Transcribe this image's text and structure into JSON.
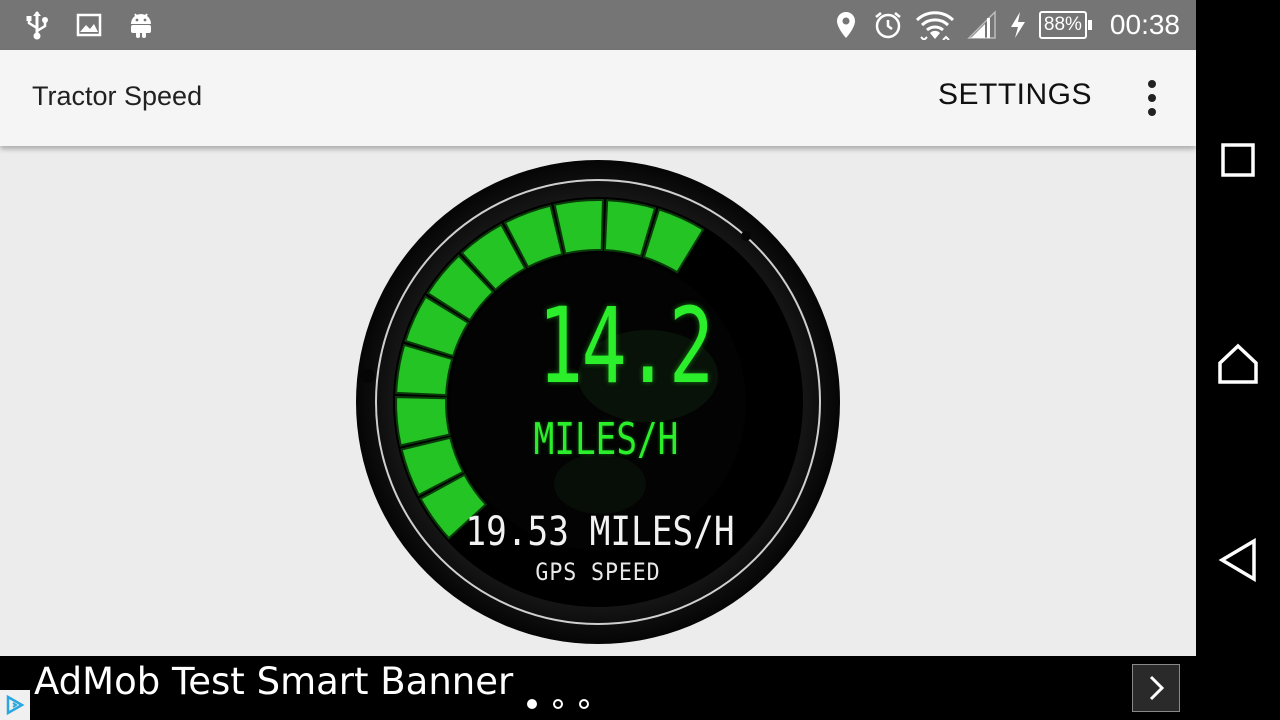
{
  "status_bar": {
    "left_icons": [
      "usb-icon",
      "image-icon",
      "android-icon"
    ],
    "right_icons": [
      "location-icon",
      "alarm-icon",
      "wifi-icon",
      "signal-icon",
      "charging-icon"
    ],
    "battery": "88%",
    "time": "00:38"
  },
  "app_bar": {
    "title": "Tractor Speed",
    "settings_label": "SETTINGS",
    "overflow_icon": "more-vert-icon"
  },
  "gauge": {
    "speed_value": "14.2",
    "speed_unit": "MILES/H",
    "gps_value": "19.53 MILES/H",
    "gps_label": "GPS SPEED",
    "lit_segments": 11,
    "accent_color": "#2bef2b",
    "face_color": "#000000"
  },
  "ad_banner": {
    "text": "AdMob Test Smart Banner",
    "pages": 3,
    "active_page": 0
  },
  "nav_bar": {
    "buttons": [
      "recents-icon",
      "home-icon",
      "back-icon"
    ]
  }
}
